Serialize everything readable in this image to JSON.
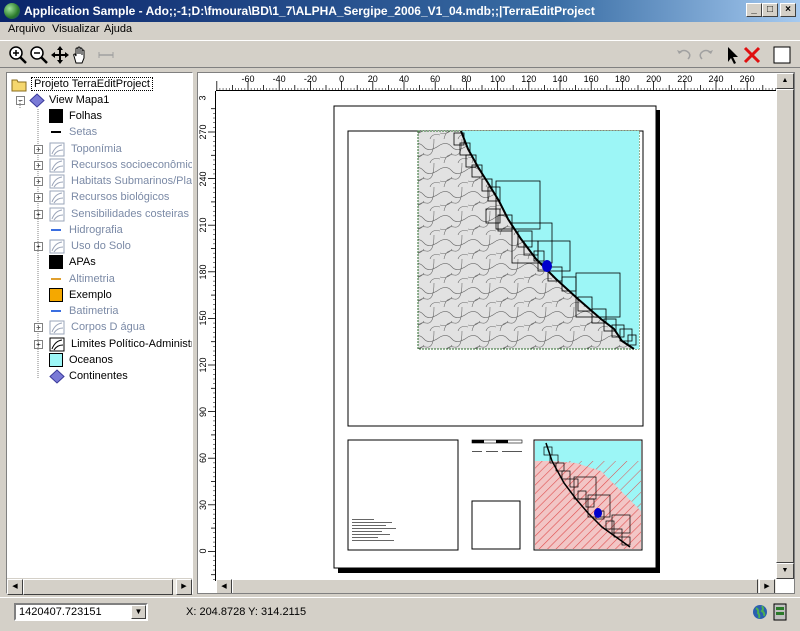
{
  "window": {
    "title": "Application Sample - Ado;;-1;D:\\fmoura\\BD\\1_7\\ALPHA_Sergipe_2006_V1_04.mdb;;|TerraEditProject",
    "min_label": "_",
    "max_label": "□",
    "close_label": "×"
  },
  "menu": {
    "items": [
      "Arquivo",
      "Visualizar",
      "Ajuda"
    ]
  },
  "tree": {
    "project_label": "Projeto TerraEditProject",
    "view_label": "View Mapa1",
    "layers": [
      {
        "label": "Folhas",
        "style": "black",
        "expandable": false,
        "gray": false
      },
      {
        "label": "Setas",
        "style": "line-black",
        "expandable": false,
        "gray": true
      },
      {
        "label": "Toponímia",
        "style": "legend",
        "expandable": true,
        "gray": true
      },
      {
        "label": "Recursos socioeconômicos",
        "style": "legend",
        "expandable": true,
        "gray": true
      },
      {
        "label": "Habitats Submarinos/Plantas",
        "style": "legend",
        "expandable": true,
        "gray": true
      },
      {
        "label": "Recursos biológicos",
        "style": "legend",
        "expandable": true,
        "gray": true
      },
      {
        "label": "Sensibilidades costeiras",
        "style": "legend",
        "expandable": true,
        "gray": true
      },
      {
        "label": "Hidrografia",
        "style": "line-blue",
        "expandable": false,
        "gray": true
      },
      {
        "label": "Uso do Solo",
        "style": "legend",
        "expandable": true,
        "gray": true
      },
      {
        "label": "APAs",
        "style": "black",
        "expandable": false,
        "gray": false
      },
      {
        "label": "Altimetria",
        "style": "line-orange",
        "expandable": false,
        "gray": true
      },
      {
        "label": "Exemplo",
        "style": "orange",
        "expandable": false,
        "gray": false
      },
      {
        "label": "Batimetria",
        "style": "line-blue",
        "expandable": false,
        "gray": true
      },
      {
        "label": "Corpos D água",
        "style": "legend",
        "expandable": true,
        "gray": true
      },
      {
        "label": "Limites Político-Administrativos",
        "style": "legend-black",
        "expandable": true,
        "gray": false
      },
      {
        "label": "Oceanos",
        "style": "cyan",
        "expandable": false,
        "gray": false
      },
      {
        "label": "Continentes",
        "style": "diamond",
        "expandable": false,
        "gray": false
      }
    ]
  },
  "rulers": {
    "h_ticks": [
      "-60",
      "-40",
      "-20",
      "0",
      "20",
      "40",
      "60",
      "80",
      "100",
      "120",
      "140",
      "160",
      "180",
      "200",
      "220",
      "240",
      "260"
    ],
    "v_ticks": [
      "270",
      "240",
      "210",
      "180",
      "150",
      "120",
      "90",
      "60",
      "30",
      "0"
    ],
    "v_top_label": "3"
  },
  "status": {
    "scale": "1420407.723151",
    "coords": "X: 204.8728  Y: 314.2115"
  },
  "colors": {
    "ocean": "#9cf6f6",
    "land": "#e2e2e2",
    "apa": "#0000cc",
    "hatch": "#e05050",
    "title_start": "#0a246a"
  }
}
